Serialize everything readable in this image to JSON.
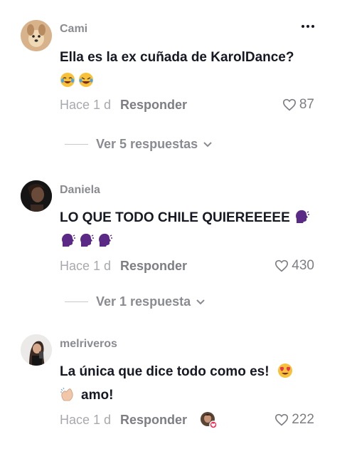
{
  "comments": [
    {
      "username": "Cami",
      "text": "Ella es la ex cuñada de KarolDance?",
      "emojis": [
        "face-with-tears-of-joy",
        "rolling-on-floor-laughing"
      ],
      "time": "Hace 1 d",
      "reply_label": "Responder",
      "likes": "87",
      "view_replies": "Ver 5 respuestas"
    },
    {
      "username": "Daniela",
      "text": "LO QUE TODO CHILE QUIEREEEEE",
      "emojis": [
        "speaking-head",
        "speaking-head",
        "speaking-head",
        "speaking-head"
      ],
      "time": "Hace 1 d",
      "reply_label": "Responder",
      "likes": "430",
      "view_replies": "Ver 1 respuesta"
    },
    {
      "username": "melriveros",
      "text": "La única que dice todo como es!",
      "text2": "amo!",
      "emojis": [
        "heart-eyes",
        "clapping-hands"
      ],
      "time": "Hace 1 d",
      "reply_label": "Responder",
      "likes": "222",
      "liked_by_creator": true
    }
  ],
  "colors": {
    "primary_text": "#161823",
    "secondary_text": "#8a8b91",
    "muted_text": "#a8a9ae",
    "speaking_head": "#5b2a86",
    "like_badge": "#fe2c55"
  }
}
